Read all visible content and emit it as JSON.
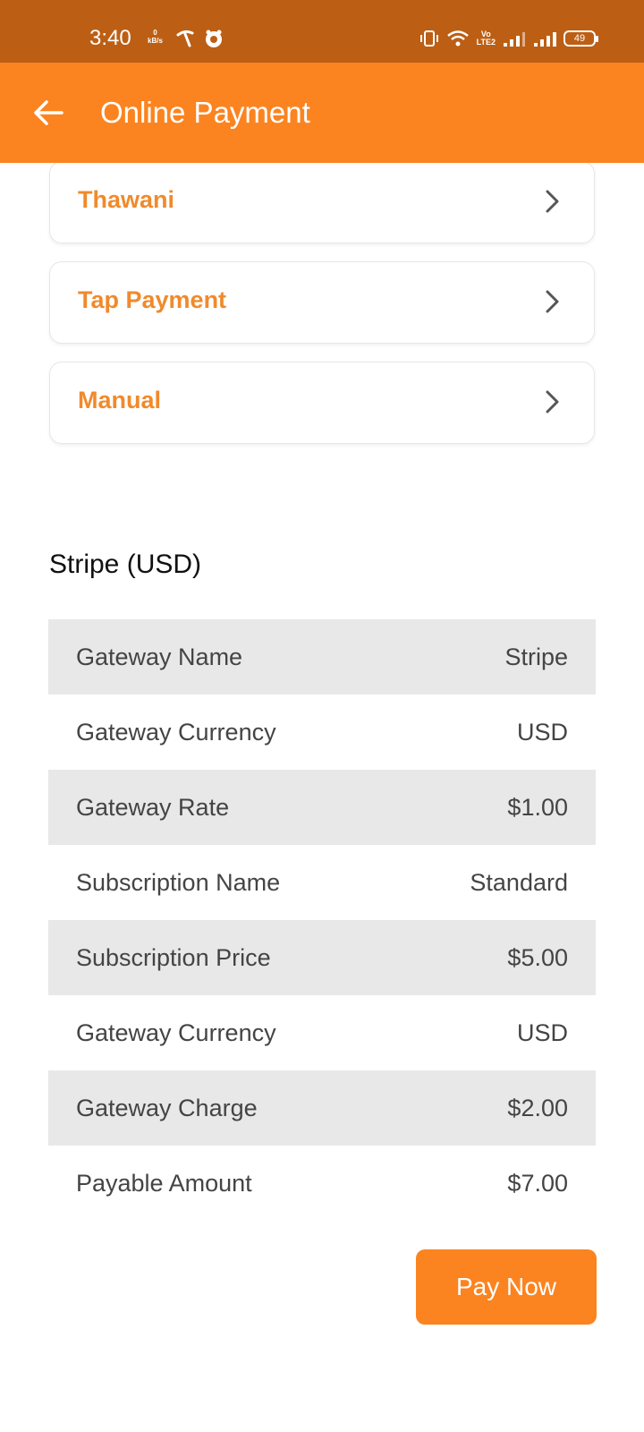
{
  "status_bar": {
    "time": "3:40",
    "net_speed_value": "0",
    "net_speed_unit": "kB/s",
    "volte_top": "Vo",
    "volte_bottom": "LTE2",
    "battery": "49"
  },
  "app_bar": {
    "title": "Online Payment",
    "back_icon": "arrow-left-icon"
  },
  "payment_methods": [
    {
      "label": "Thawani",
      "icon": "chevron-right-icon"
    },
    {
      "label": "Tap Payment",
      "icon": "chevron-right-icon"
    },
    {
      "label": "Manual",
      "icon": "chevron-right-icon"
    }
  ],
  "details": {
    "title": "Stripe (USD)",
    "rows": [
      {
        "label": "Gateway Name",
        "value": "Stripe"
      },
      {
        "label": "Gateway Currency",
        "value": "USD"
      },
      {
        "label": "Gateway Rate",
        "value": "$1.00"
      },
      {
        "label": "Subscription Name",
        "value": "Standard"
      },
      {
        "label": "Subscription Price",
        "value": "$5.00"
      },
      {
        "label": "Gateway Currency",
        "value": "USD"
      },
      {
        "label": "Gateway Charge",
        "value": "$2.00"
      },
      {
        "label": "Payable Amount",
        "value": "$7.00"
      }
    ]
  },
  "pay_button": {
    "label": "Pay Now"
  },
  "colors": {
    "status_bar": "#BC5F14",
    "primary": "#FB8420",
    "method_text": "#F08A2C",
    "row_shade": "#E8E8E8"
  }
}
